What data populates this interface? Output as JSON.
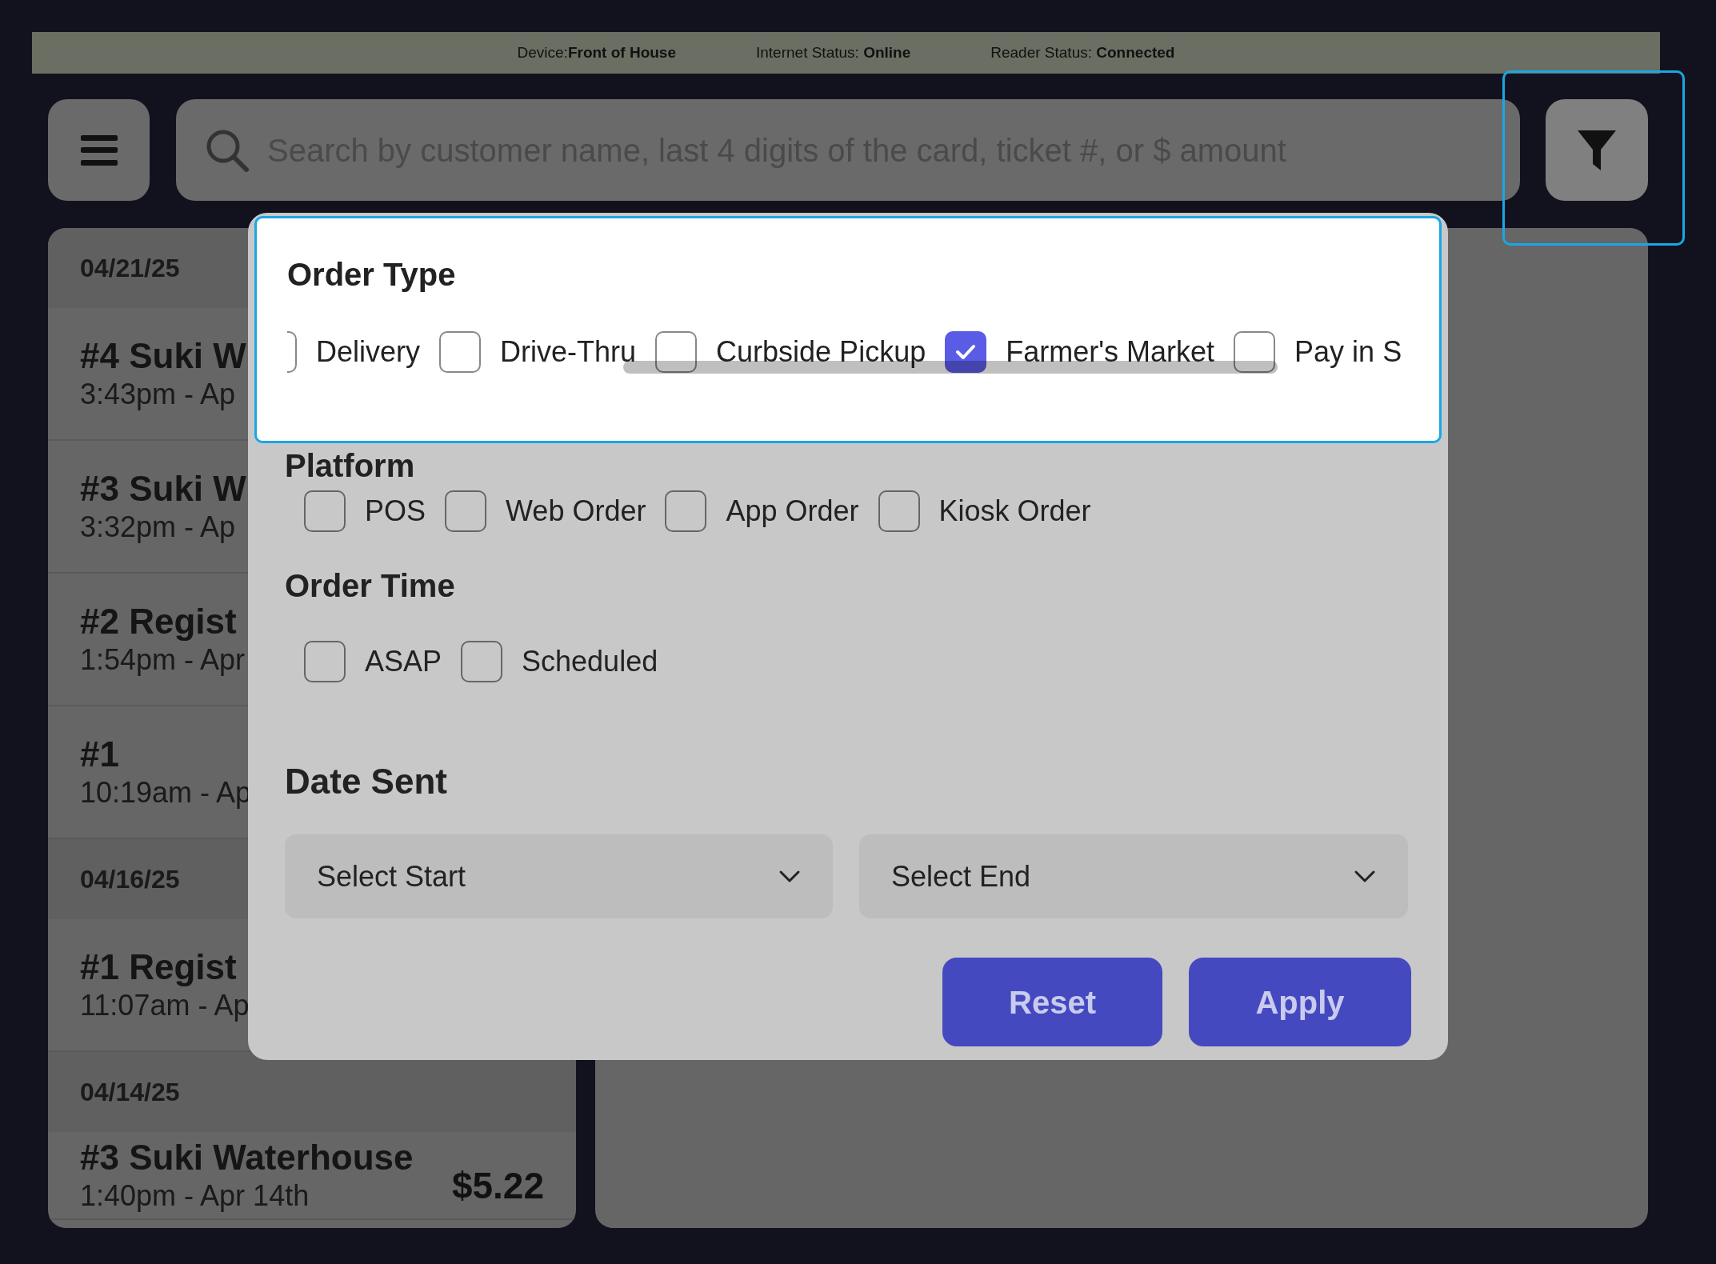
{
  "status_bar": {
    "device_label": "Device:",
    "device": "Front of House",
    "internet_label": "Internet Status: ",
    "internet": "Online",
    "reader_label": "Reader Status: ",
    "reader": "Connected"
  },
  "search": {
    "placeholder": "Search by customer name, last 4 digits of the card, ticket #, or $ amount"
  },
  "orders": [
    {
      "kind": "date",
      "text": "04/21/25"
    },
    {
      "kind": "order",
      "title": "#4 Suki W",
      "time": "3:43pm - Ap"
    },
    {
      "kind": "order",
      "title": "#3 Suki W",
      "time": "3:32pm - Ap"
    },
    {
      "kind": "order",
      "title": "#2 Regist",
      "time": "1:54pm - Apr"
    },
    {
      "kind": "order",
      "title": "#1",
      "time": "10:19am - Ap"
    },
    {
      "kind": "date",
      "text": "04/16/25"
    },
    {
      "kind": "order",
      "title": "#1 Regist",
      "time": "11:07am - Ap"
    },
    {
      "kind": "date",
      "text": "04/14/25"
    },
    {
      "kind": "order",
      "title": "#3 Suki Waterhouse",
      "time": "1:40pm - Apr 14th",
      "amount": "$5.22"
    }
  ],
  "filter": {
    "order_type": {
      "title": "Order Type",
      "options": [
        {
          "label": "Delivery",
          "checked": false
        },
        {
          "label": "Drive-Thru",
          "checked": false
        },
        {
          "label": "Curbside Pickup",
          "checked": false
        },
        {
          "label": "Farmer's Market",
          "checked": true
        },
        {
          "label": "Pay in S",
          "checked": false
        }
      ]
    },
    "platform": {
      "title": "Platform",
      "options": [
        {
          "label": "POS",
          "checked": false
        },
        {
          "label": "Web Order",
          "checked": false
        },
        {
          "label": "App Order",
          "checked": false
        },
        {
          "label": "Kiosk Order",
          "checked": false
        }
      ]
    },
    "order_time": {
      "title": "Order Time",
      "options": [
        {
          "label": "ASAP",
          "checked": false
        },
        {
          "label": "Scheduled",
          "checked": false
        }
      ]
    },
    "date_sent": {
      "title": "Date Sent",
      "start": "Select Start",
      "end": "Select End"
    },
    "buttons": [
      "Reset",
      "Apply"
    ]
  }
}
